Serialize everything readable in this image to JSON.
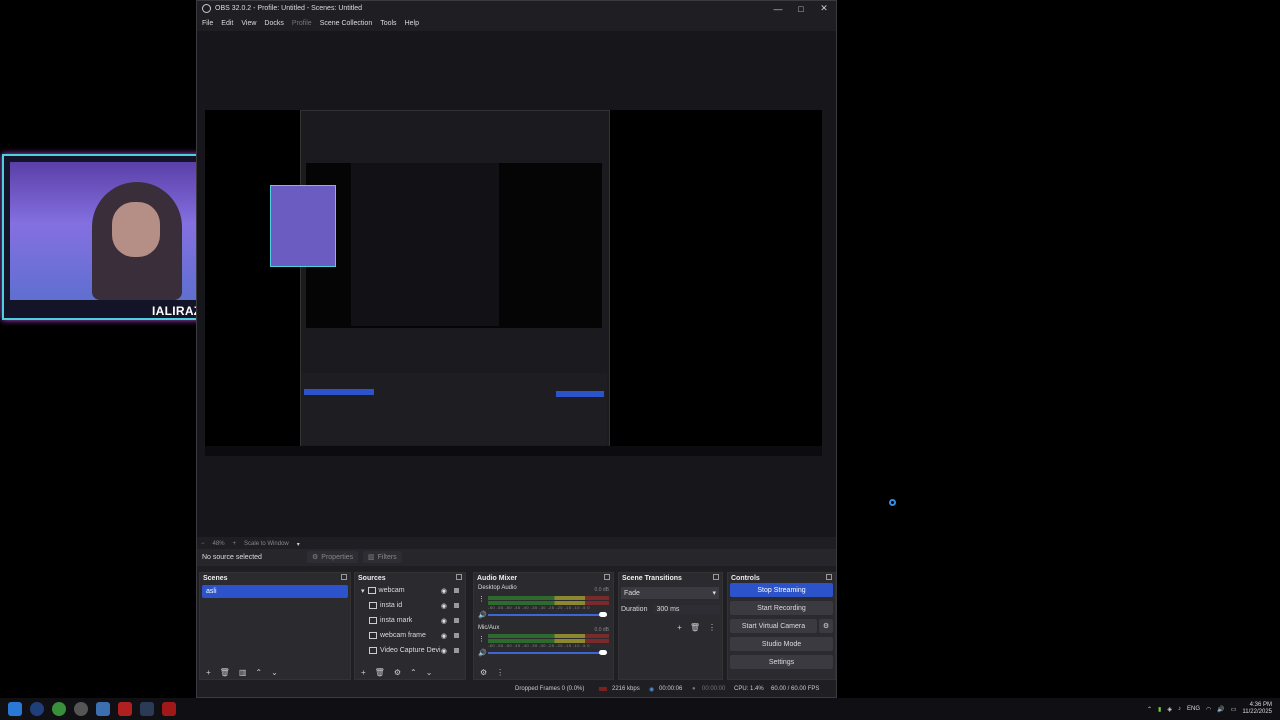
{
  "window": {
    "title": "OBS 32.0.2 - Profile: Untitled - Scenes: Untitled",
    "controls": [
      "—",
      "□",
      "✕"
    ]
  },
  "menu": [
    "File",
    "Edit",
    "View",
    "Docks",
    "Profile",
    "Scene Collection",
    "Tools",
    "Help"
  ],
  "preview": {
    "zoom_minus": "−",
    "zoom_value": "48%",
    "zoom_plus": "+",
    "scale_mode": "Scale to Window"
  },
  "source_bar": {
    "status": "No source selected",
    "properties": "Properties",
    "filters": "Filters"
  },
  "overlay": {
    "name": "IALIRAZAVI"
  },
  "scenes": {
    "title": "Scenes",
    "items": [
      "asli"
    ]
  },
  "sources": {
    "title": "Sources",
    "items": [
      "webcam",
      "insta id",
      "insta mark",
      "webcam frame",
      "Video Capture Devi"
    ]
  },
  "mixer": {
    "title": "Audio Mixer",
    "channels": [
      {
        "name": "Desktop Audio",
        "db": "0.0 dB"
      },
      {
        "name": "Mic/Aux",
        "db": "0.0 dB"
      }
    ],
    "scale": "-60 -55 -50 -45 -40 -35 -30 -25 -20 -15 -10 -5 0"
  },
  "transitions": {
    "title": "Scene Transitions",
    "type": "Fade",
    "duration_label": "Duration",
    "duration_value": "300 ms"
  },
  "controls": {
    "title": "Controls",
    "stop_streaming": "Stop Streaming",
    "start_recording": "Start Recording",
    "start_virtual_camera": "Start Virtual Camera",
    "studio_mode": "Studio Mode",
    "settings": "Settings"
  },
  "status": {
    "dropped": "Dropped Frames 0 (0.0%)",
    "bitrate": "2216 kbps",
    "stream_time": "00:00:06",
    "rec_time": "00:00:00",
    "cpu": "CPU: 1.4%",
    "fps": "60.00 / 60.00 FPS"
  },
  "taskbar": {
    "lang": "ENG",
    "time": "4:36 PM",
    "date": "11/22/2025"
  },
  "colors": {
    "accent": "#2c53c9",
    "panel": "#2a2a2f",
    "window_bg": "#1e1e23"
  }
}
